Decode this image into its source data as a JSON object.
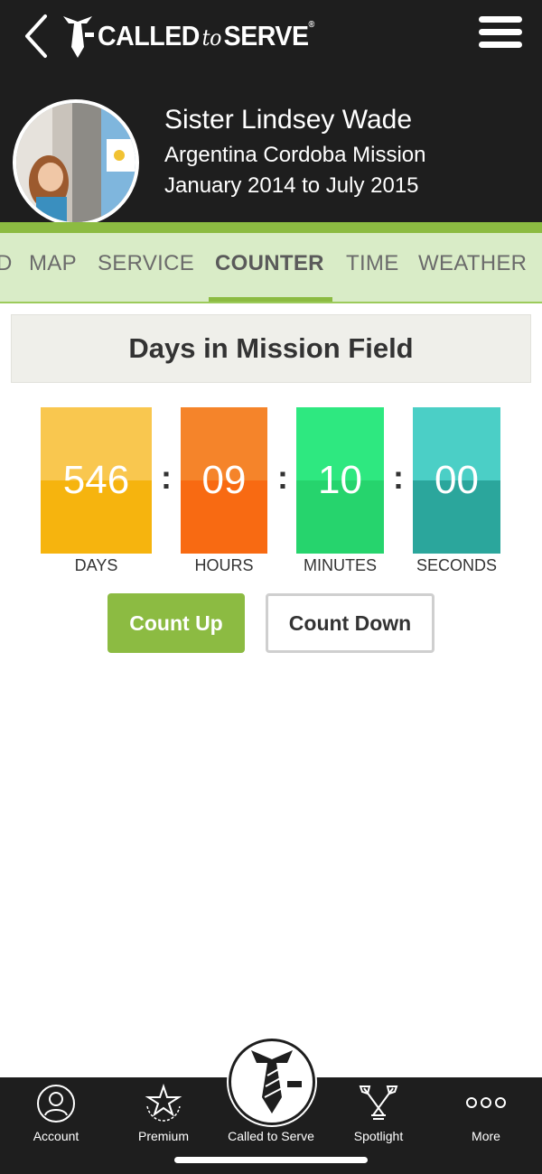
{
  "header": {
    "logo_text_left": "CALLED",
    "logo_text_to": "to",
    "logo_text_right": "SERVE",
    "logo_registered": "®"
  },
  "profile": {
    "name": "Sister Lindsey Wade",
    "mission": "Argentina Cordoba Mission",
    "dates": "January 2014 to July 2015"
  },
  "tabs": [
    {
      "label": "D"
    },
    {
      "label": "MAP"
    },
    {
      "label": "SERVICE"
    },
    {
      "label": "COUNTER",
      "active": true
    },
    {
      "label": "TIME"
    },
    {
      "label": "WEATHER"
    }
  ],
  "counter": {
    "title": "Days in Mission Field",
    "separator": ":",
    "units": [
      {
        "value": "546",
        "label": "DAYS",
        "color_top": "#f9c74f",
        "color_bottom": "#f6b40e"
      },
      {
        "value": "09",
        "label": "HOURS",
        "color_top": "#f5842a",
        "color_bottom": "#f86a12"
      },
      {
        "value": "10",
        "label": "MINUTES",
        "color_top": "#2ee880",
        "color_bottom": "#26d46d"
      },
      {
        "value": "00",
        "label": "SECONDS",
        "color_top": "#4bcfc6",
        "color_bottom": "#2ba69c"
      }
    ],
    "buttons": {
      "count_up": "Count Up",
      "count_down": "Count Down"
    }
  },
  "bottom_nav": [
    {
      "label": "Account",
      "icon": "account-icon"
    },
    {
      "label": "Premium",
      "icon": "premium-star-icon"
    },
    {
      "label": "Called to Serve",
      "icon": "tie-icon"
    },
    {
      "label": "Spotlight",
      "icon": "spotlight-icon"
    },
    {
      "label": "More",
      "icon": "more-dots-icon"
    }
  ],
  "colors": {
    "header_bg": "#1e1e1e",
    "accent_green": "#8cbb42",
    "tab_bg": "#d9ecc7"
  }
}
